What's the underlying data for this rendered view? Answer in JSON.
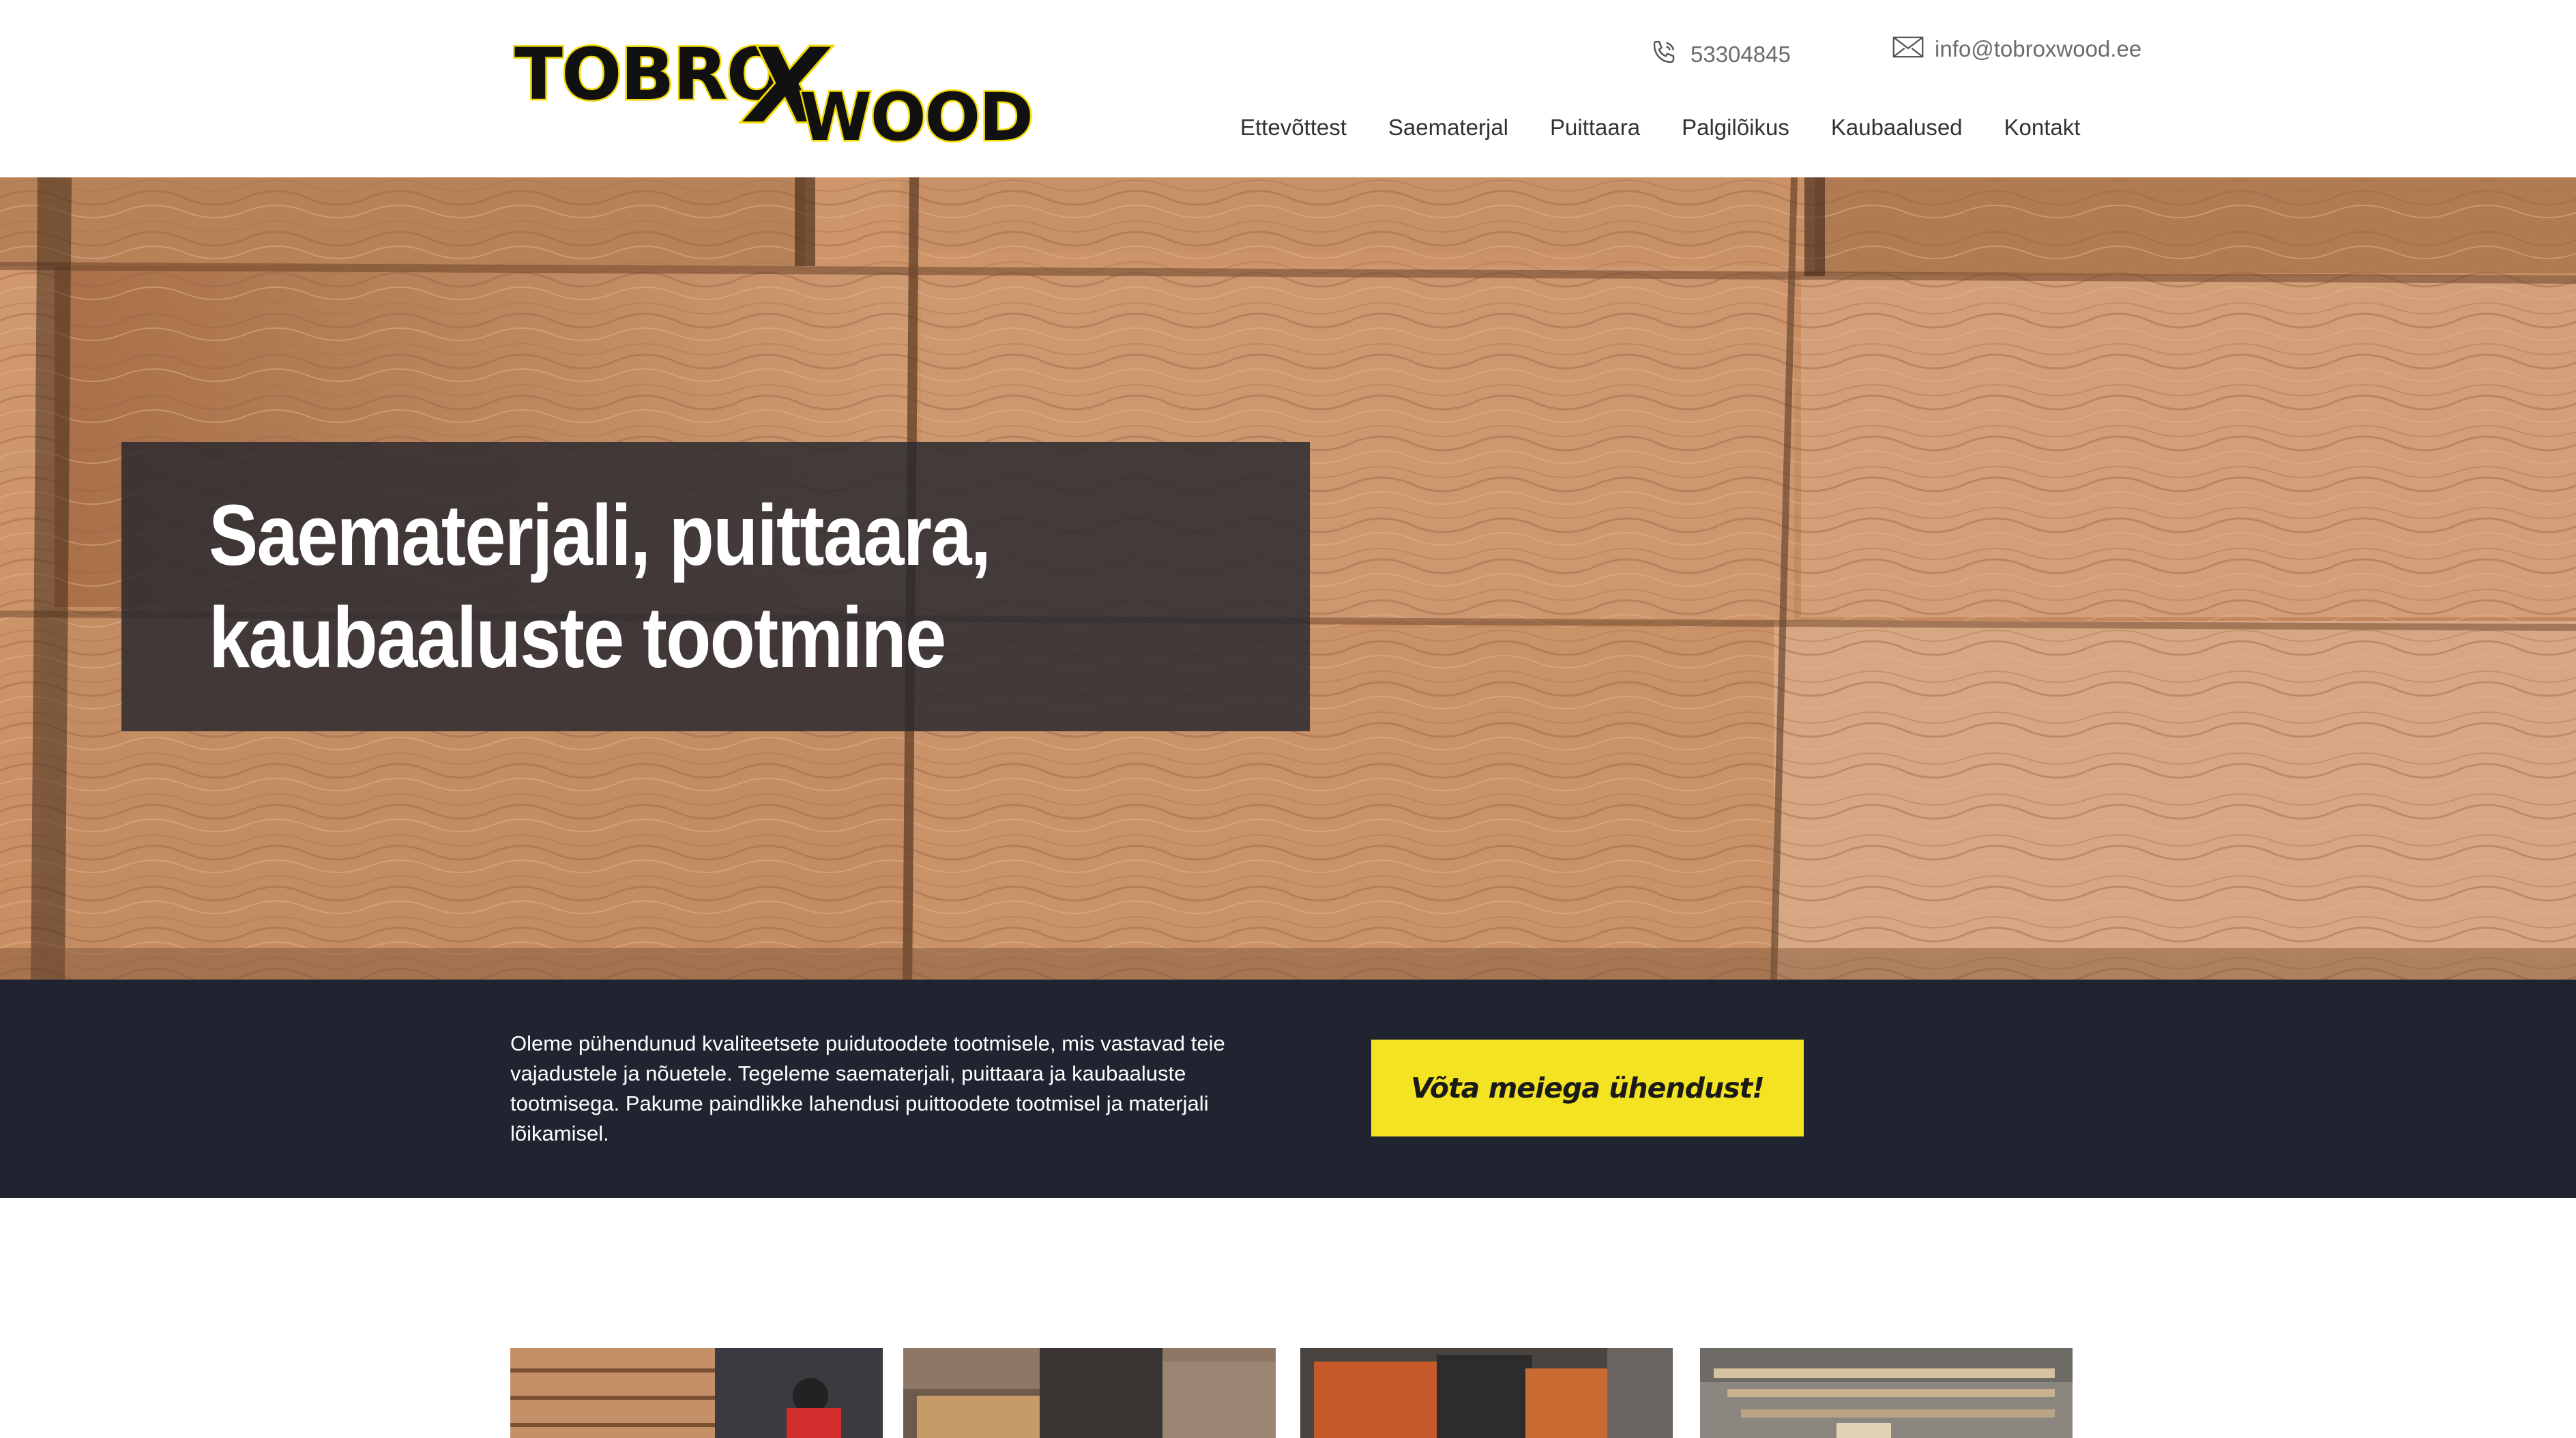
{
  "brand": {
    "logo_top": "TOBRO",
    "logo_x": "X",
    "logo_bottom": "WOOD",
    "accent": "#f2d900",
    "dark": "#1f2430",
    "cta_color": "#f4e322"
  },
  "header": {
    "phone": "53304845",
    "email": "info@tobroxwood.ee",
    "nav": [
      "Ettevõttest",
      "Saematerjal",
      "Puittaara",
      "Palgilõikus",
      "Kaubaalused",
      "Kontakt"
    ]
  },
  "hero": {
    "title_line1": "Saematerjali, puittaara,",
    "title_line2": "kaubaaluste tootmine"
  },
  "band": {
    "text": "Oleme pühendunud kvaliteetsete puidutoodete tootmisele, mis vastavad teie vajadustele ja nõuetele. Tegeleme saematerjali, puittaara ja kaubaaluste tootmisega. Pakume paindlikke lahendusi puittoodete tootmisel ja materjali lõikamisel.",
    "cta": "Võta meiega ühendust!"
  },
  "icons": {
    "phone": "phone-icon",
    "email": "envelope-icon"
  }
}
